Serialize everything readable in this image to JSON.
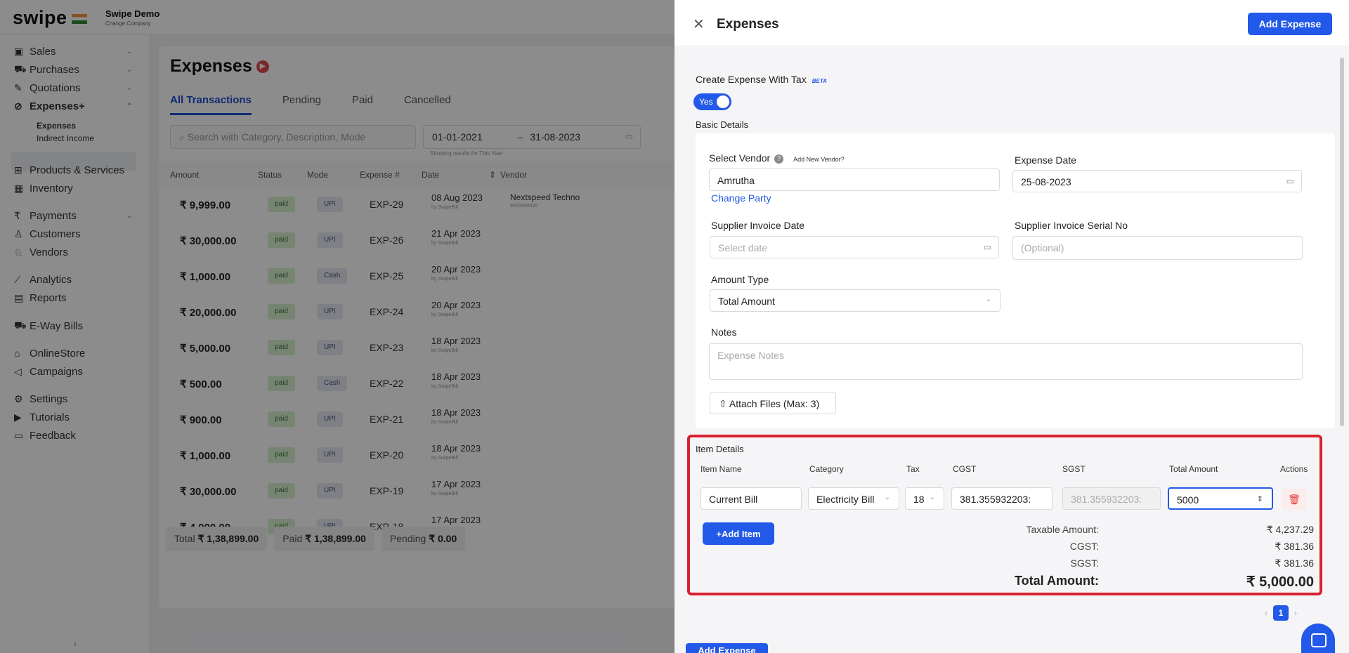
{
  "app": {
    "logo": "swipe",
    "company": "Swipe Demo",
    "company_sub": "Change Company"
  },
  "sidebar": {
    "items": [
      {
        "label": "Sales",
        "icon": "cash-icon",
        "chevron": true
      },
      {
        "label": "Purchases",
        "icon": "cart-icon",
        "chevron": true
      },
      {
        "label": "Quotations",
        "icon": "pen-icon",
        "chevron": true
      },
      {
        "label": "Expenses+",
        "icon": "tag-icon",
        "chevron": true
      },
      {
        "label": "Products & Services",
        "icon": "box-icon",
        "chevron": false
      },
      {
        "label": "Inventory",
        "icon": "warehouse-icon",
        "chevron": false
      },
      {
        "label": "Payments",
        "icon": "rupee-icon",
        "chevron": true
      },
      {
        "label": "Customers",
        "icon": "user-icon",
        "chevron": false
      },
      {
        "label": "Vendors",
        "icon": "users-icon",
        "chevron": false
      },
      {
        "label": "Analytics",
        "icon": "chart-icon",
        "chevron": false
      },
      {
        "label": "Reports",
        "icon": "report-icon",
        "chevron": false
      },
      {
        "label": "E-Way Bills",
        "icon": "truck-icon",
        "chevron": false
      },
      {
        "label": "OnlineStore",
        "icon": "store-icon",
        "chevron": false
      },
      {
        "label": "Campaigns",
        "icon": "megaphone-icon",
        "chevron": false
      },
      {
        "label": "Settings",
        "icon": "gear-icon",
        "chevron": false
      },
      {
        "label": "Tutorials",
        "icon": "youtube-icon",
        "chevron": false
      },
      {
        "label": "Feedback",
        "icon": "chat-icon",
        "chevron": false
      }
    ],
    "sub_items": [
      "Expenses",
      "Indirect Income"
    ]
  },
  "main": {
    "title": "Expenses",
    "tabs": [
      "All Transactions",
      "Pending",
      "Paid",
      "Cancelled"
    ],
    "search_placeholder": "Search with Category, Description, Mode",
    "date_from": "01-01-2021",
    "date_to": "31-08-2023",
    "date_hint": "Showing results for This Year",
    "columns": [
      "Amount",
      "Status",
      "Mode",
      "Expense #",
      "Date",
      "Vendor"
    ],
    "rows": [
      {
        "amount": "₹ 9,999.00",
        "status": "paid",
        "mode": "UPI",
        "no": "EXP-29",
        "date": "08 Aug 2023",
        "by": "by SwipeBill",
        "vendor": "Nextspeed Techno",
        "vendor_sub": "9000000000"
      },
      {
        "amount": "₹ 30,000.00",
        "status": "paid",
        "mode": "UPI",
        "no": "EXP-26",
        "date": "21 Apr 2023",
        "by": "by SwipeBill",
        "vendor": "",
        "vendor_sub": ""
      },
      {
        "amount": "₹ 1,000.00",
        "status": "paid",
        "mode": "Cash",
        "no": "EXP-25",
        "date": "20 Apr 2023",
        "by": "by SwipeBill",
        "vendor": "",
        "vendor_sub": ""
      },
      {
        "amount": "₹ 20,000.00",
        "status": "paid",
        "mode": "UPI",
        "no": "EXP-24",
        "date": "20 Apr 2023",
        "by": "by SwipeBill",
        "vendor": "",
        "vendor_sub": ""
      },
      {
        "amount": "₹ 5,000.00",
        "status": "paid",
        "mode": "UPI",
        "no": "EXP-23",
        "date": "18 Apr 2023",
        "by": "by SwipeBill",
        "vendor": "",
        "vendor_sub": ""
      },
      {
        "amount": "₹ 500.00",
        "status": "paid",
        "mode": "Cash",
        "no": "EXP-22",
        "date": "18 Apr 2023",
        "by": "by SwipeBill",
        "vendor": "",
        "vendor_sub": ""
      },
      {
        "amount": "₹ 900.00",
        "status": "paid",
        "mode": "UPI",
        "no": "EXP-21",
        "date": "18 Apr 2023",
        "by": "by SwipeBill",
        "vendor": "",
        "vendor_sub": ""
      },
      {
        "amount": "₹ 1,000.00",
        "status": "paid",
        "mode": "UPI",
        "no": "EXP-20",
        "date": "18 Apr 2023",
        "by": "by SwipeBill",
        "vendor": "",
        "vendor_sub": ""
      },
      {
        "amount": "₹ 30,000.00",
        "status": "paid",
        "mode": "UPI",
        "no": "EXP-19",
        "date": "17 Apr 2023",
        "by": "by SwipeBill",
        "vendor": "",
        "vendor_sub": ""
      },
      {
        "amount": "₹ 4,000.00",
        "status": "paid",
        "mode": "UPI",
        "no": "EXP-18",
        "date": "17 Apr 2023",
        "by": "by SwipeBill",
        "vendor": "",
        "vendor_sub": ""
      }
    ],
    "totals": {
      "total_label": "Total",
      "total": "₹ 1,38,899.00",
      "paid_label": "Paid",
      "paid": "₹ 1,38,899.00",
      "pending_label": "Pending",
      "pending": "₹ 0.00"
    }
  },
  "drawer": {
    "title": "Expenses",
    "add_expense_label": "Add Expense",
    "tax_label": "Create Expense With Tax",
    "beta": "BETA",
    "toggle": "Yes",
    "basic_details": "Basic Details",
    "vendor_label": "Select Vendor",
    "add_new_vendor": "Add New Vendor?",
    "vendor_value": "Amrutha",
    "change_party": "Change Party",
    "expense_date_label": "Expense Date",
    "expense_date": "25-08-2023",
    "supplier_inv_date_label": "Supplier Invoice Date",
    "supplier_inv_date_placeholder": "Select date",
    "supplier_serial_label": "Supplier Invoice Serial No",
    "supplier_serial_placeholder": "(Optional)",
    "amount_type_label": "Amount Type",
    "amount_type": "Total Amount",
    "notes_label": "Notes",
    "notes_placeholder": "Expense Notes",
    "attach_label": "Attach Files (Max: 3)",
    "item_details": "Item Details",
    "item_columns": [
      "Item Name",
      "Category",
      "Tax",
      "CGST",
      "SGST",
      "Total Amount",
      "Actions"
    ],
    "item": {
      "name": "Current Bill",
      "category": "Electricity Bill",
      "tax": "18",
      "cgst": "381.355932203:",
      "sgst": "381.355932203:",
      "total": "5000"
    },
    "add_item_label": "+Add Item",
    "summary": {
      "taxable_label": "Taxable Amount:",
      "taxable": "₹ 4,237.29",
      "cgst_label": "CGST:",
      "cgst": "₹ 381.36",
      "sgst_label": "SGST:",
      "sgst": "₹ 381.36",
      "total_label": "Total Amount:",
      "total": "₹ 5,000.00"
    },
    "page": "1",
    "bottom_button": "Add Expense"
  }
}
